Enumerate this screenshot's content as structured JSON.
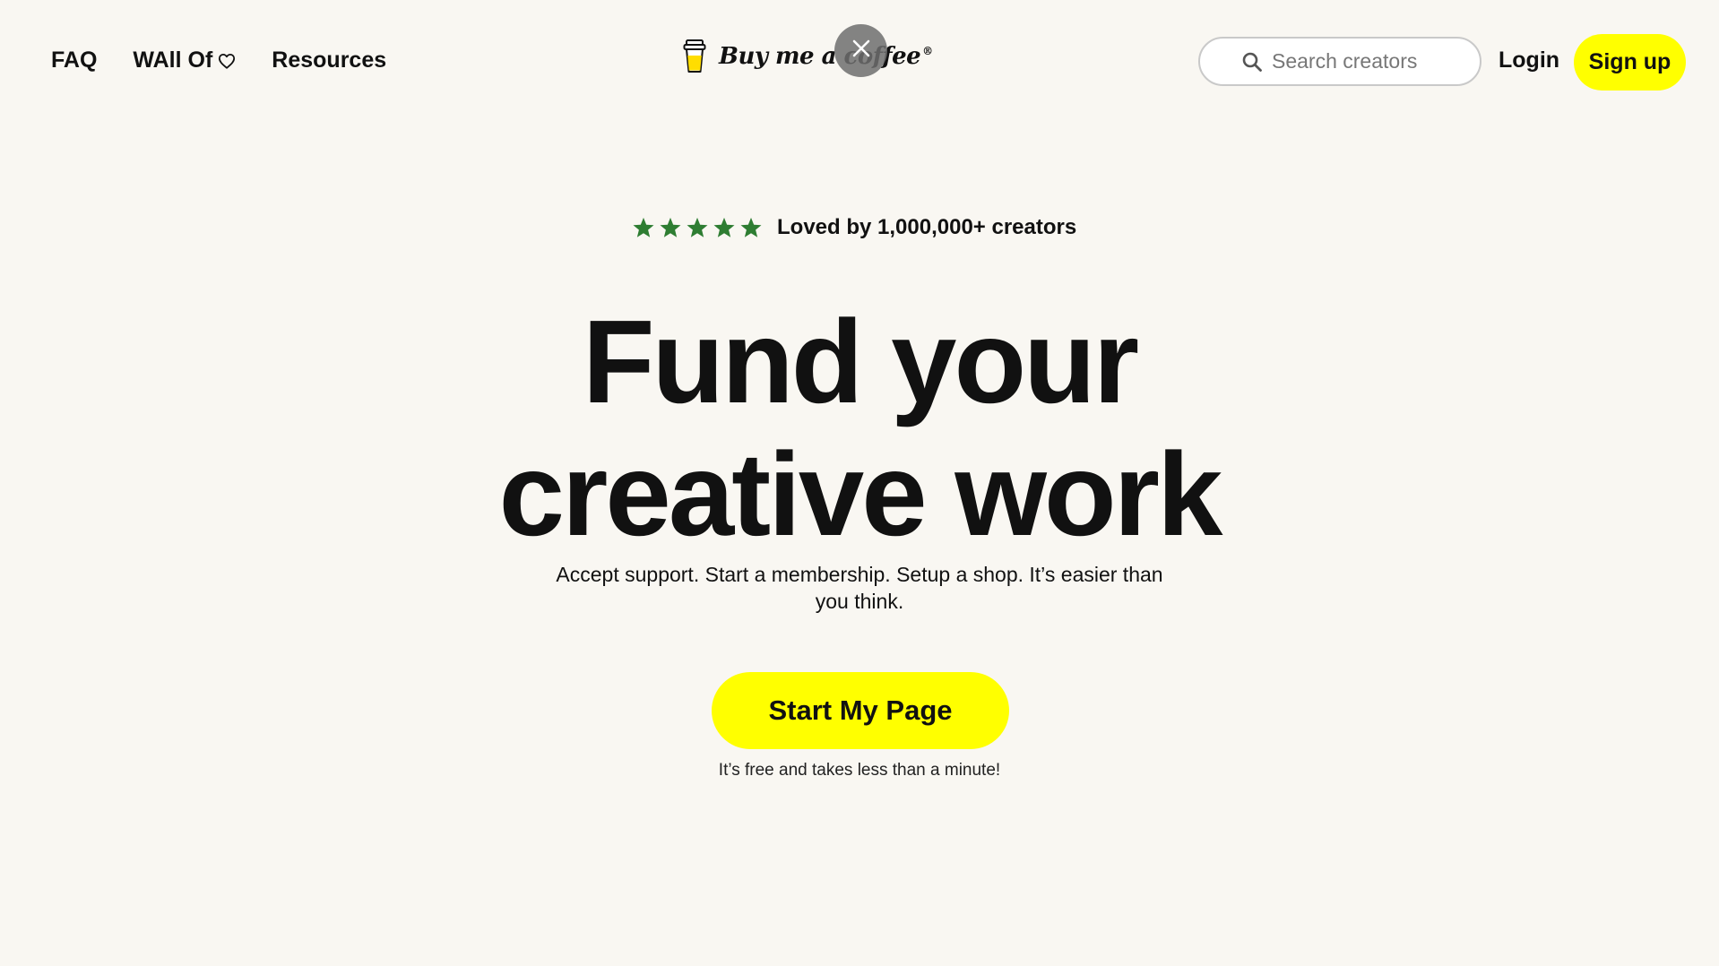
{
  "header": {
    "nav": {
      "faq": "FAQ",
      "wall_of": "WAll Of",
      "resources": "Resources"
    },
    "logo": {
      "text": "Buy me a coffee",
      "registered": "®",
      "icon": "coffee-cup-icon"
    },
    "overlay_close_icon": "close-icon",
    "search": {
      "placeholder": "Search creators",
      "value": "",
      "icon": "search-icon"
    },
    "login_label": "Login",
    "signup_label": "Sign up"
  },
  "hero": {
    "stars_count": 5,
    "star_color": "#2e7d32",
    "rating_text": "Loved by 1,000,000+ creators",
    "headline_line1": "Fund your",
    "headline_line2": "creative work",
    "subtext": "Accept support. Start a membership. Setup a shop. It’s easier than you think.",
    "cta_label": "Start My Page",
    "cta_note": "It’s free and takes less than a minute!"
  },
  "colors": {
    "background": "#f9f7f2",
    "accent_yellow": "#ffff00",
    "text": "#111111"
  }
}
